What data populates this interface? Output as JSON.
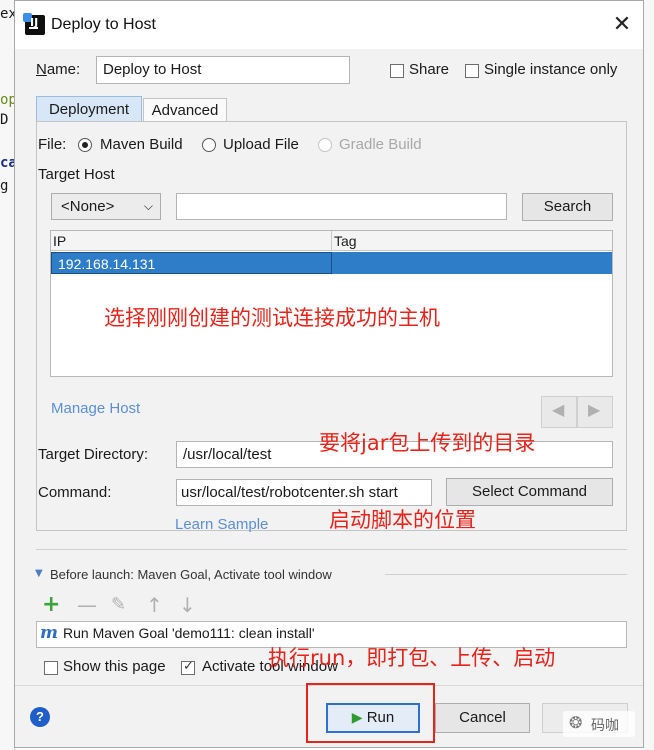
{
  "background": {
    "fragments": [
      "ex",
      "op",
      "D",
      "ca",
      "g"
    ]
  },
  "dialog": {
    "title": "Deploy to Host",
    "close_glyph": "✕"
  },
  "name_row": {
    "label": "Name:",
    "value": "Deploy to Host",
    "share_label": "Share",
    "single_instance_label": "Single instance only",
    "share_checked": false,
    "single_instance_checked": false
  },
  "tabs": [
    {
      "label": "Deployment",
      "active": true
    },
    {
      "label": "Advanced",
      "active": false
    }
  ],
  "file_row": {
    "label": "File:",
    "options": [
      {
        "label": "Maven Build",
        "selected": true,
        "enabled": true
      },
      {
        "label": "Upload File",
        "selected": false,
        "enabled": true
      },
      {
        "label": "Gradle Build",
        "selected": false,
        "enabled": false
      }
    ]
  },
  "target_host": {
    "label": "Target Host",
    "dropdown_value": "<None>",
    "search_value": "",
    "search_button": "Search",
    "columns": [
      "IP",
      "Tag"
    ],
    "rows": [
      {
        "ip": "192.168.14.131",
        "tag": "",
        "selected": true
      }
    ],
    "manage_link": "Manage Host"
  },
  "target_directory": {
    "label": "Target Directory:",
    "value": "/usr/local/test"
  },
  "command": {
    "label": "Command:",
    "value": "usr/local/test/robotcenter.sh start",
    "select_button": "Select Command",
    "learn_link": "Learn Sample"
  },
  "before_launch": {
    "header": "Before launch: Maven Goal, Activate tool window",
    "tool_icons": [
      "add-icon",
      "remove-icon",
      "edit-icon",
      "move-up-icon",
      "move-down-icon"
    ],
    "task": "Run Maven Goal 'demo111: clean install'",
    "show_page_label": "Show this page",
    "show_page_checked": false,
    "activate_label": "Activate tool window",
    "activate_checked": true
  },
  "footer": {
    "help_glyph": "?",
    "run_label": "Run",
    "cancel_label": "Cancel"
  },
  "annotations": {
    "select_host": "选择刚刚创建的测试连接成功的主机",
    "upload_dir": "要将jar包上传到的目录",
    "script_location": "启动脚本的位置",
    "run_note": "执行run，即打包、上传、启动"
  },
  "watermark": "码咖",
  "colors": {
    "selection": "#2e7dc8",
    "annotation": "#e8231a",
    "link": "#5a8fd8",
    "add_icon": "#3aa53a"
  }
}
